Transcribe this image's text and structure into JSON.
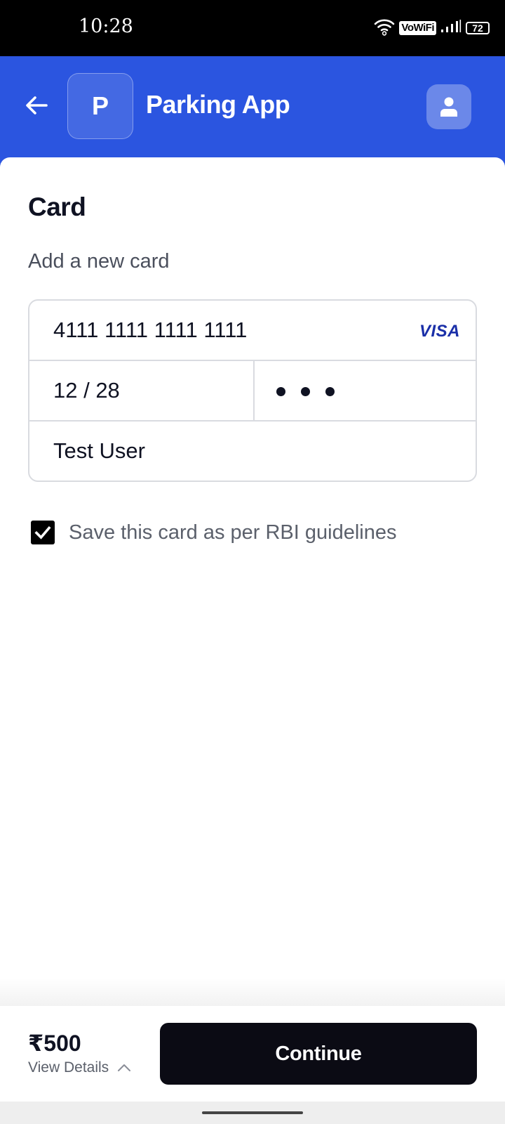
{
  "status_bar": {
    "time": "10:28",
    "network_label": "VoWiFi",
    "battery_level": "72",
    "icons": [
      "wifi-icon",
      "signal-icon",
      "battery-icon"
    ]
  },
  "header": {
    "logo_letter": "P",
    "title": "Parking App",
    "back_icon": "arrow-left-icon",
    "profile_icon": "user-icon",
    "background_color": "#2b55e0"
  },
  "card_section": {
    "title": "Card",
    "subtitle": "Add a new card",
    "card_number": "4111 1111 1111 1111",
    "card_brand": "VISA",
    "expiry": "12 / 28",
    "cvv_masked_length": 3,
    "holder_name": "Test User"
  },
  "save_card": {
    "checked": true,
    "label": "Save this card as per RBI guidelines"
  },
  "footer": {
    "amount": "₹500",
    "view_details": "View Details",
    "continue_label": "Continue"
  }
}
